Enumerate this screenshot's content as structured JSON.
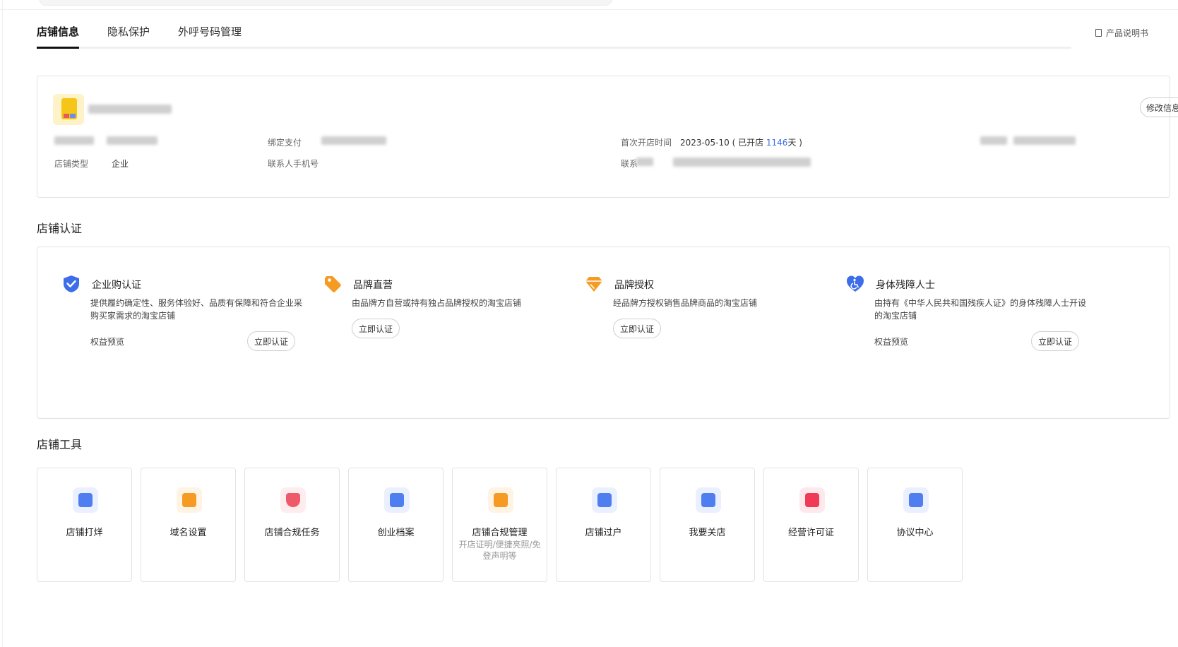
{
  "tabs": [
    {
      "label": "店铺信息",
      "active": true
    },
    {
      "label": "隐私保护",
      "active": false
    },
    {
      "label": "外呼号码管理",
      "active": false
    }
  ],
  "manual_link": "产品说明书",
  "shop_info": {
    "edit_button": "修改信息",
    "fields": {
      "shop_type_label": "店铺类型",
      "shop_type_value": "企业",
      "bind_pay_label": "绑定支付",
      "contact_phone_label": "联系人手机号",
      "open_time_label": "首次开店时间",
      "open_date": "2023-05-10",
      "opened_prefix": "( 已开店 ",
      "opened_days": "1146",
      "opened_suffix": "天 )",
      "contact_label": "联系"
    }
  },
  "certification": {
    "title": "店铺认证",
    "items": [
      {
        "title": "企业购认证",
        "icon": "shield-check-icon",
        "color": "#3c6eea",
        "desc": "提供履约确定性、服务体验好、品质有保障和符合企业采购买家需求的淘宝店铺",
        "benefit": "权益预览",
        "button": "立即认证"
      },
      {
        "title": "品牌直营",
        "icon": "tag-icon",
        "color": "#f59a23",
        "desc": "由品牌方自营或持有独占品牌授权的淘宝店铺",
        "button": "立即认证"
      },
      {
        "title": "品牌授权",
        "icon": "diamond-icon",
        "color": "#f59a23",
        "desc": "经品牌方授权销售品牌商品的淘宝店铺",
        "button": "立即认证"
      },
      {
        "title": "身体残障人士",
        "icon": "heart-accessibility-icon",
        "color": "#3c6eea",
        "desc": "由持有《中华人民共和国残疾人证》的身体残障人士开设的淘宝店铺",
        "benefit": "权益预览",
        "button": "立即认证"
      }
    ]
  },
  "tools": {
    "title": "店铺工具",
    "items": [
      {
        "name": "店铺打烊",
        "icon": "shop-close-icon",
        "color": "#4f7ef0",
        "bg": "#eaf0ff"
      },
      {
        "name": "域名设置",
        "icon": "domain-icon",
        "color": "#f59a23",
        "bg": "#fff3e3"
      },
      {
        "name": "店铺合规任务",
        "icon": "compliance-shield-icon",
        "color": "#ef5a6a",
        "bg": "#ffecee"
      },
      {
        "name": "创业档案",
        "icon": "archive-icon",
        "color": "#4f7ef0",
        "bg": "#eaf0ff"
      },
      {
        "name": "店铺合规管理",
        "sub": "开店证明/便捷亮照/免登声明等",
        "icon": "compliance-doc-icon",
        "color": "#f59a23",
        "bg": "#fff3e3"
      },
      {
        "name": "店铺过户",
        "icon": "transfer-icon",
        "color": "#4f7ef0",
        "bg": "#eaf0ff"
      },
      {
        "name": "我要关店",
        "icon": "close-shop-icon",
        "color": "#4f7ef0",
        "bg": "#eaf0ff"
      },
      {
        "name": "经营许可证",
        "icon": "license-icon",
        "color": "#ef3b58",
        "bg": "#ffe8ec"
      },
      {
        "name": "协议中心",
        "icon": "agreement-icon",
        "color": "#4f7ef0",
        "bg": "#eaf0ff"
      }
    ]
  }
}
